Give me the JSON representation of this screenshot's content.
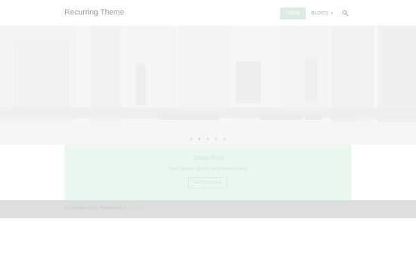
{
  "header": {
    "site_title": "Recurring Theme",
    "nav": {
      "home_label": "HOME",
      "blogs_label": "BLOGS",
      "blogs_caret": "▾"
    }
  },
  "hero": {
    "active_slide": 2,
    "slide_count": 5
  },
  "sticky": {
    "title": "Sticky Post",
    "text": "Read our post about a quick getting started",
    "button_label": "GET STARTED"
  },
  "footer": {
    "copyright": "© Copyright 2015. Powered by ",
    "powered_by_link": "WordPress"
  },
  "colors": {
    "accent": "#dcebe2",
    "sticky_bg": "#e9f7ee",
    "footer_bg": "#dedede"
  },
  "icons": {
    "search": "search-icon",
    "caret": "chevron-down-icon"
  }
}
